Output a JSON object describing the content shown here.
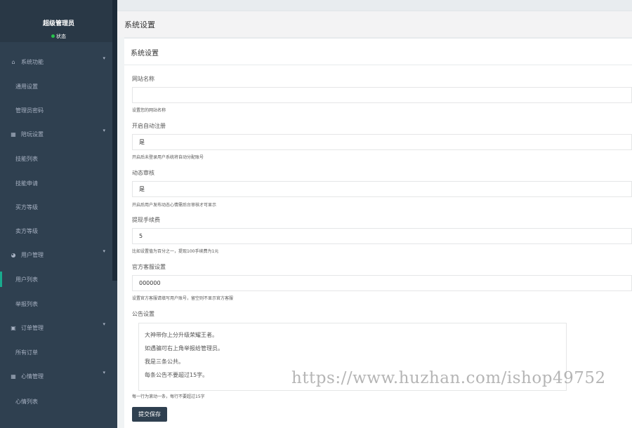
{
  "sidebar": {
    "profile_name": "超级管理员",
    "profile_status": "状态",
    "status_color": "#27c24c",
    "menu": [
      {
        "type": "group",
        "label": "系统功能",
        "icon": "home-icon"
      },
      {
        "type": "sub",
        "label": "通用设置"
      },
      {
        "type": "sub",
        "label": "管理员密码"
      },
      {
        "type": "group",
        "label": "陪玩设置",
        "icon": "grid-icon"
      },
      {
        "type": "sub",
        "label": "技能列表"
      },
      {
        "type": "sub",
        "label": "技能申请"
      },
      {
        "type": "sub",
        "label": "买方等级"
      },
      {
        "type": "sub",
        "label": "卖方等级"
      },
      {
        "type": "group",
        "label": "用户管理",
        "icon": "pie-icon"
      },
      {
        "type": "sub",
        "label": "用户列表"
      },
      {
        "type": "sub",
        "label": "举报列表"
      },
      {
        "type": "group",
        "label": "订单管理",
        "icon": "monitor-icon"
      },
      {
        "type": "sub",
        "label": "所有订单"
      },
      {
        "type": "group",
        "label": "心情管理",
        "icon": "grid-icon"
      },
      {
        "type": "sub",
        "label": "心情列表"
      }
    ]
  },
  "header": {
    "title": "系统设置"
  },
  "panel": {
    "title": "系统设置"
  },
  "form": {
    "site_name": {
      "label": "网站名称",
      "value": "",
      "help": "设置您的网站名称"
    },
    "auto_register": {
      "label": "开启自动注册",
      "value": "是",
      "help": "开启后未登录用户系统将自动分配账号"
    },
    "dynamic_review": {
      "label": "动态审核",
      "value": "是",
      "help": "开启后用户发布动态心情需后台审核才可显示"
    },
    "withdraw_fee": {
      "label": "提现手续费",
      "value": "5",
      "help": "比如设置值为百分之一，提现100手续费为1元"
    },
    "official_service": {
      "label": "官方客服设置",
      "value": "000000",
      "help": "设置官方客服请填写用户账号，留空则不显示官方客服"
    },
    "notice": {
      "label": "公告设置",
      "lines": [
        "大神带你上分升级荣耀王者。",
        "如遇骗可右上角举报给管理员。",
        "我是三条公共。",
        "每条公告不要超过15字。"
      ],
      "help": "每一行为滚动一条，每行不要超过15字"
    },
    "submit_label": "提交保存"
  },
  "watermark": "https://www.huzhan.com/ishop49752"
}
